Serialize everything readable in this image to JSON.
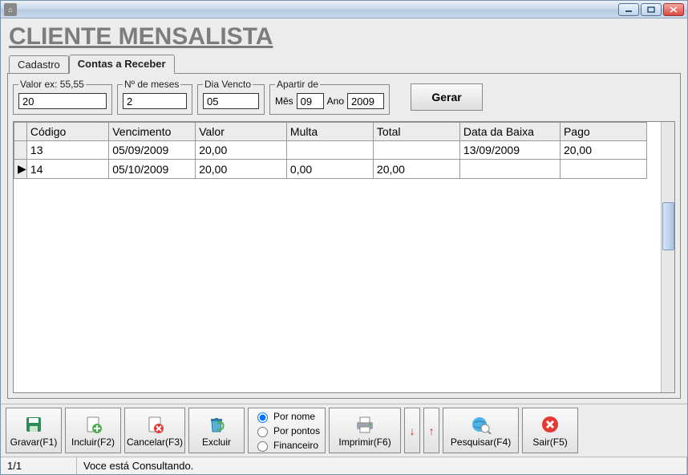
{
  "window": {
    "title": ""
  },
  "page": {
    "title": "CLIENTE MENSALISTA"
  },
  "tabs": {
    "cadastro": "Cadastro",
    "contas": "Contas a Receber"
  },
  "filters": {
    "valor_label": "Valor  ex: 55,55",
    "valor_value": "20",
    "meses_label": "Nº de meses",
    "meses_value": "2",
    "dia_label": "Dia Vencto",
    "dia_value": "05",
    "apartir_label": "Apartir de",
    "mes_label": "Mês",
    "mes_value": "09",
    "ano_label": "Ano",
    "ano_value": "2009",
    "gerar": "Gerar"
  },
  "grid": {
    "headers": {
      "codigo": "Código",
      "venc": "Vencimento",
      "valor": "Valor",
      "multa": "Multa",
      "total": "Total",
      "baixa": "Data da Baixa",
      "pago": "Pago"
    },
    "rows": [
      {
        "current": false,
        "codigo": "13",
        "venc": "05/09/2009",
        "valor": "20,00",
        "multa": "",
        "total": "",
        "baixa": "13/09/2009",
        "pago": "20,00"
      },
      {
        "current": true,
        "codigo": "14",
        "venc": "05/10/2009",
        "valor": "20,00",
        "multa": "0,00",
        "total": "20,00",
        "baixa": "",
        "pago": ""
      }
    ]
  },
  "toolbar": {
    "gravar": "Gravar(F1)",
    "incluir": "Incluir(F2)",
    "cancelar": "Cancelar(F3)",
    "excluir": "Excluir",
    "imprimir": "Imprimir(F6)",
    "pesquisar": "Pesquisar(F4)",
    "sair": "Sair(F5)",
    "radios": {
      "nome": "Por nome",
      "pontos": "Por pontos",
      "financeiro": "Financeiro"
    }
  },
  "status": {
    "pos": "1/1",
    "msg": "Voce está Consultando."
  }
}
